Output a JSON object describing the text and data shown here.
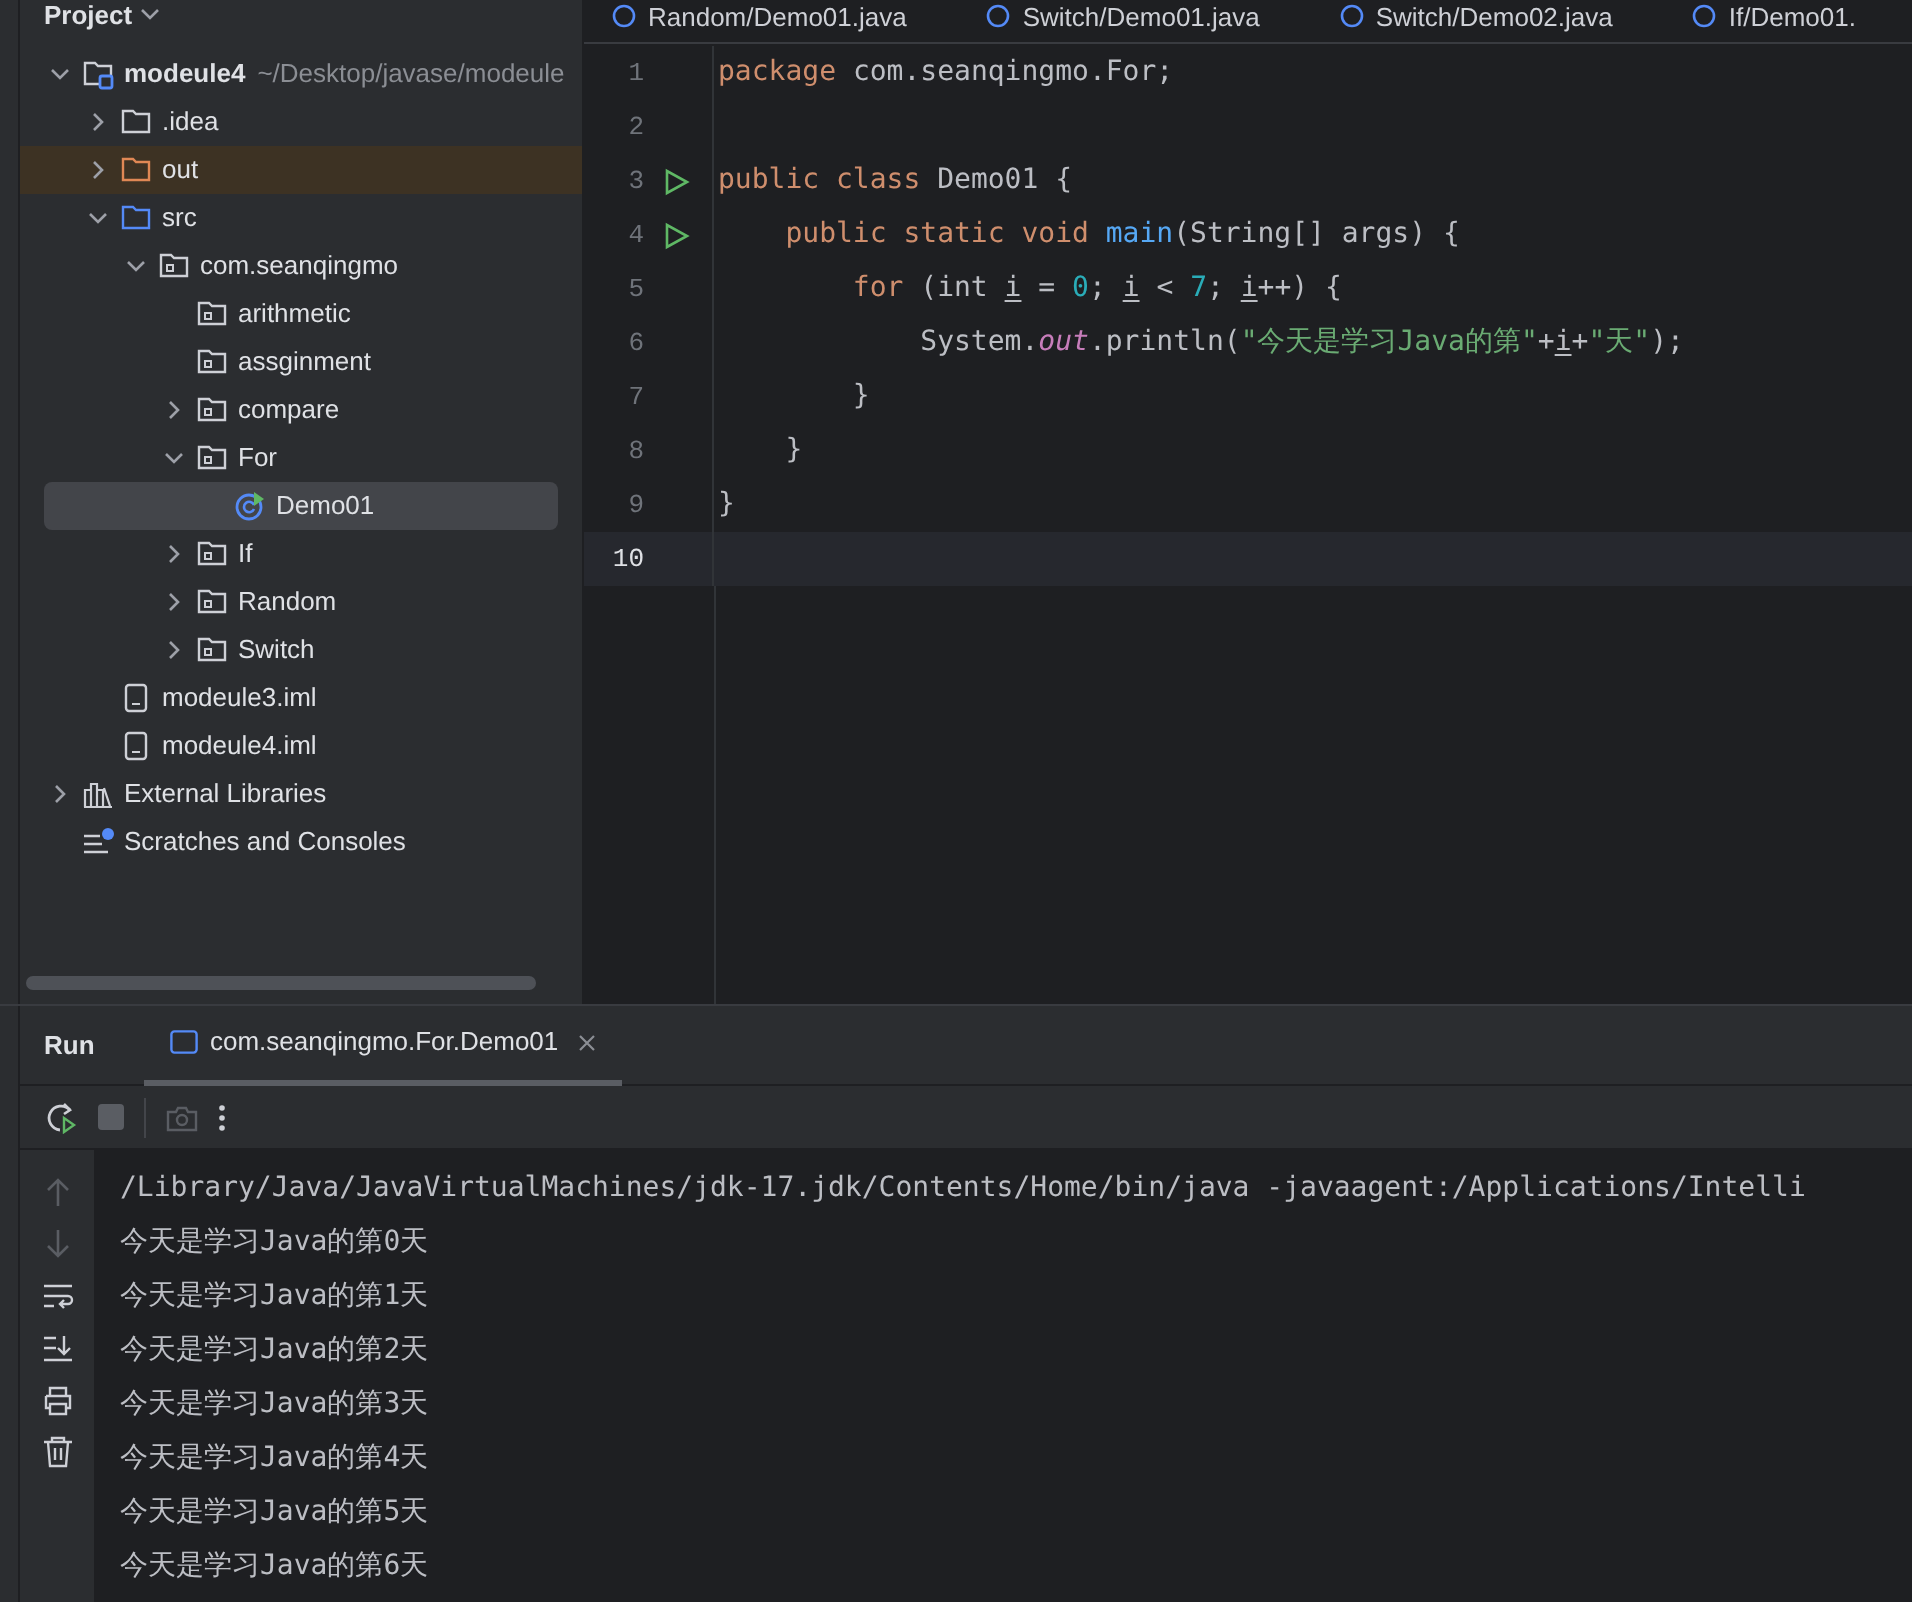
{
  "project_panel": {
    "title": "Project",
    "tree": [
      {
        "label": "modeule4",
        "path": "~/Desktop/javase/modeule",
        "kind": "module",
        "expanded": true,
        "selected": false,
        "children": [
          {
            "label": ".idea",
            "kind": "folder",
            "expanded": false,
            "selected": false
          },
          {
            "label": "out",
            "kind": "excluded",
            "expanded": false,
            "selected": false
          },
          {
            "label": "src",
            "kind": "source",
            "expanded": true,
            "selected": false,
            "children": [
              {
                "label": "com.seanqingmo",
                "kind": "package",
                "expanded": true,
                "selected": false,
                "children": [
                  {
                    "label": "arithmetic",
                    "kind": "package",
                    "selected": false
                  },
                  {
                    "label": "assginment",
                    "kind": "package",
                    "selected": false
                  },
                  {
                    "label": "compare",
                    "kind": "package",
                    "expanded": false,
                    "selected": false
                  },
                  {
                    "label": "For",
                    "kind": "package",
                    "expanded": true,
                    "selected": false,
                    "children": [
                      {
                        "label": "Demo01",
                        "kind": "class",
                        "selected": true
                      }
                    ]
                  },
                  {
                    "label": "If",
                    "kind": "package",
                    "expanded": false,
                    "selected": false
                  },
                  {
                    "label": "Random",
                    "kind": "package",
                    "expanded": false,
                    "selected": false
                  },
                  {
                    "label": "Switch",
                    "kind": "package",
                    "expanded": false,
                    "selected": false
                  }
                ]
              }
            ]
          },
          {
            "label": "modeule3.iml",
            "kind": "file",
            "selected": false
          },
          {
            "label": "modeule4.iml",
            "kind": "file",
            "selected": false
          }
        ]
      },
      {
        "label": "External Libraries",
        "kind": "libraries",
        "expanded": false,
        "selected": false
      },
      {
        "label": "Scratches and Consoles",
        "kind": "scratches",
        "selected": false
      }
    ]
  },
  "editor_tabs": [
    {
      "label": "Random/Demo01.java"
    },
    {
      "label": "Switch/Demo01.java"
    },
    {
      "label": "Switch/Demo02.java"
    },
    {
      "label": "If/Demo01."
    }
  ],
  "code": [
    {
      "number": "1",
      "run": false,
      "current": false,
      "tokens": [
        {
          "kind": "keyword",
          "text": "package"
        },
        {
          "kind": "plain",
          "text": " com.seanqingmo.For;"
        }
      ]
    },
    {
      "number": "2",
      "run": false,
      "current": false
    },
    {
      "number": "3",
      "run": true,
      "current": false,
      "tokens": [
        {
          "kind": "keyword",
          "text": "public class"
        },
        {
          "kind": "plain",
          "text": " Demo01 {"
        }
      ]
    },
    {
      "number": "4",
      "run": true,
      "current": false,
      "tokens": [
        {
          "kind": "keyword",
          "text": "    public static void"
        },
        {
          "kind": "method",
          "text": " main"
        },
        {
          "kind": "plain",
          "text": "(String[] args) {"
        }
      ]
    },
    {
      "number": "5",
      "run": false,
      "current": false,
      "tokens": [
        {
          "kind": "keyword",
          "text": "        for"
        },
        {
          "kind": "plain",
          "text": " (int "
        },
        {
          "kind": "var",
          "text": "i"
        },
        {
          "kind": "plain",
          "text": " = "
        },
        {
          "kind": "number",
          "text": "0"
        },
        {
          "kind": "plain",
          "text": "; "
        },
        {
          "kind": "var",
          "text": "i"
        },
        {
          "kind": "plain",
          "text": " < "
        },
        {
          "kind": "number",
          "text": "7"
        },
        {
          "kind": "plain",
          "text": "; "
        },
        {
          "kind": "var",
          "text": "i"
        },
        {
          "kind": "plain",
          "text": "++) {"
        }
      ]
    },
    {
      "number": "6",
      "run": false,
      "current": false,
      "tokens": [
        {
          "kind": "plain",
          "text": "            System."
        },
        {
          "kind": "field",
          "text": "out"
        },
        {
          "kind": "plain",
          "text": ".println("
        },
        {
          "kind": "string",
          "text": "\"今天是学习Java的第\""
        },
        {
          "kind": "plain",
          "text": "+"
        },
        {
          "kind": "var",
          "text": "i"
        },
        {
          "kind": "plain",
          "text": "+"
        },
        {
          "kind": "string",
          "text": "\"天\""
        },
        {
          "kind": "plain",
          "text": ");"
        }
      ]
    },
    {
      "number": "7",
      "run": false,
      "current": false,
      "tokens": [
        {
          "kind": "plain",
          "text": "        }"
        }
      ]
    },
    {
      "number": "8",
      "run": false,
      "current": false,
      "tokens": [
        {
          "kind": "plain",
          "text": "    }"
        }
      ]
    },
    {
      "number": "9",
      "run": false,
      "current": false,
      "tokens": [
        {
          "kind": "plain",
          "text": "}"
        }
      ]
    },
    {
      "number": "10",
      "run": false,
      "current": true
    }
  ],
  "run_panel": {
    "title": "Run",
    "tab": {
      "label": "com.seanqingmo.For.Demo01",
      "selected": true
    },
    "console": [
      "/Library/Java/JavaVirtualMachines/jdk-17.jdk/Contents/Home/bin/java -javaagent:/Applications/Intelli",
      "今天是学习Java的第0天",
      "今天是学习Java的第1天",
      "今天是学习Java的第2天",
      "今天是学习Java的第3天",
      "今天是学习Java的第4天",
      "今天是学习Java的第5天",
      "今天是学习Java的第6天"
    ]
  }
}
